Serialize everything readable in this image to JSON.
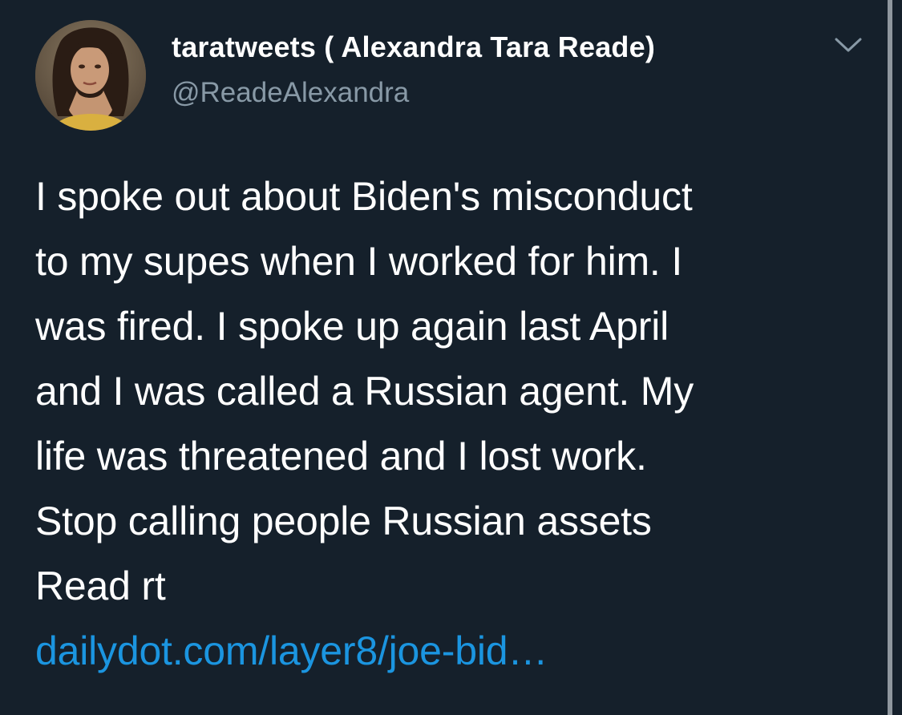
{
  "colors": {
    "background": "#15202b",
    "text": "#ffffff",
    "secondary_text": "#8899a6",
    "link": "#1b95e0",
    "scrollbar": "#8f979e"
  },
  "tweet": {
    "display_name": "taratweets ( Alexandra Tara Reade)",
    "handle": "@ReadeAlexandra",
    "avatar_icon": "profile-photo",
    "menu_icon": "chevron-down-icon",
    "text_lines": [
      "I spoke out about Biden's misconduct",
      "to my supes when I worked for him. I",
      "was fired. I spoke up again last April",
      "and I was called a Russian agent. My",
      "life was threatened and I lost work.",
      "Stop calling people Russian assets",
      "Read rt"
    ],
    "link_text": "dailydot.com/layer8/joe-bid…"
  }
}
